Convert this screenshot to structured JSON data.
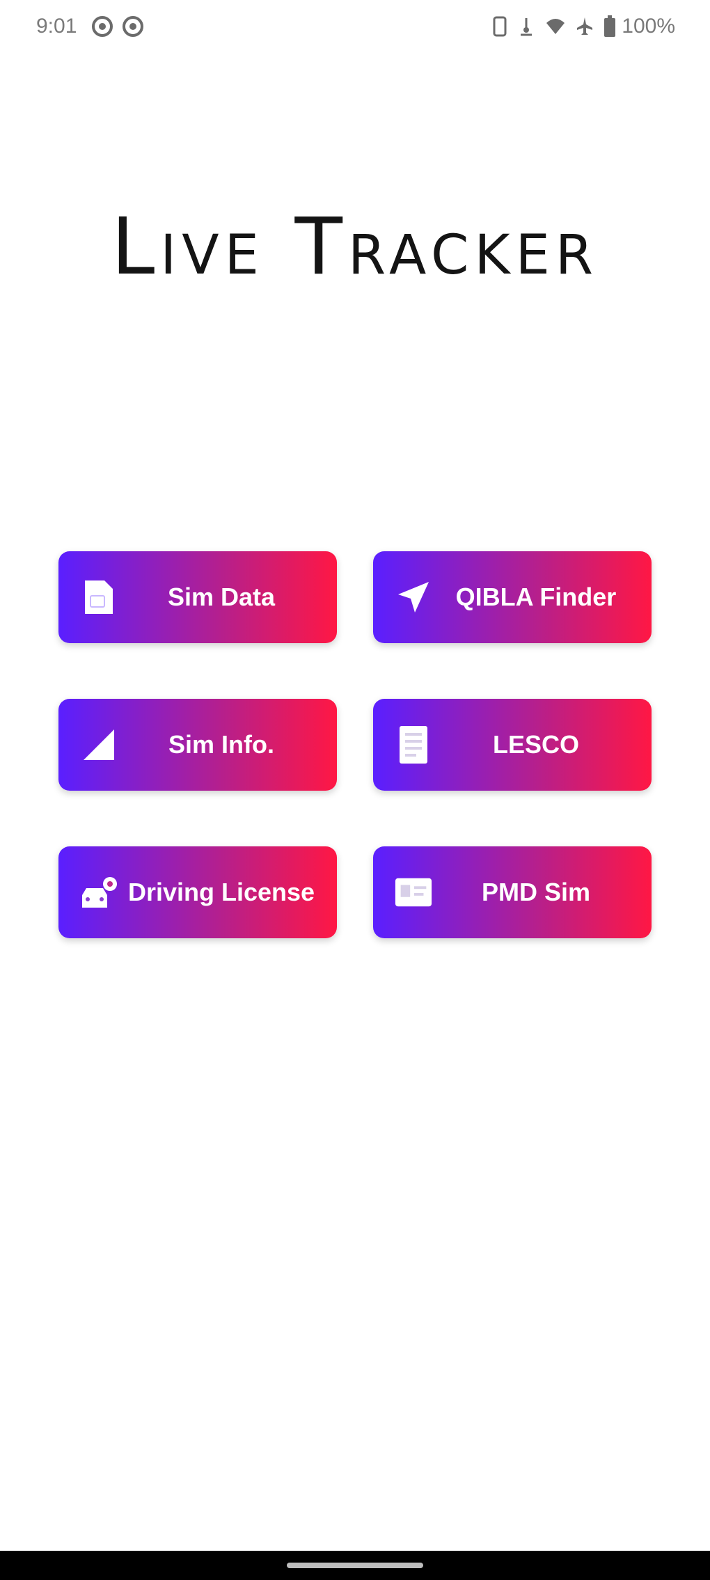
{
  "status_bar": {
    "time": "9:01",
    "battery": "100%",
    "icons": [
      "notification-icon",
      "notification-icon",
      "vibrate-icon",
      "data-saver-icon",
      "wifi-icon",
      "airplane-icon",
      "battery-icon"
    ]
  },
  "app": {
    "title": "Live Tracker"
  },
  "menu": {
    "buttons": [
      {
        "label": "Sim Data",
        "icon": "sim-card-icon"
      },
      {
        "label": "QIBLA Finder",
        "icon": "navigation-arrow-icon"
      },
      {
        "label": "Sim Info.",
        "icon": "signal-strength-icon"
      },
      {
        "label": "LESCO",
        "icon": "bill-document-icon"
      },
      {
        "label": "Driving License",
        "icon": "driver-car-icon"
      },
      {
        "label": "PMD Sim",
        "icon": "id-card-icon"
      }
    ]
  },
  "colors": {
    "gradient_start": "#5a1fff",
    "gradient_end": "#ff1744",
    "background": "#ffffff",
    "title": "#141414"
  }
}
